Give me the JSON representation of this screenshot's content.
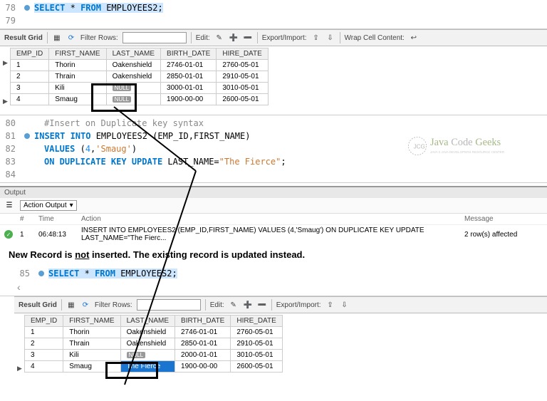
{
  "editor1": {
    "l78": {
      "no": "78",
      "sql": {
        "select": "SELECT",
        "star": "*",
        "from": "FROM",
        "tbl": "EMPLOYEES2",
        "semi": ";"
      }
    },
    "l79": {
      "no": "79"
    }
  },
  "toolbar": {
    "resultgrid": "Result Grid",
    "filter": "Filter Rows:",
    "edit": "Edit:",
    "expimp": "Export/Import:",
    "wrap": "Wrap Cell Content:"
  },
  "table1": {
    "hdr": {
      "c1": "EMP_ID",
      "c2": "FIRST_NAME",
      "c3": "LAST_NAME",
      "c4": "BIRTH_DATE",
      "c5": "HIRE_DATE"
    },
    "rows": [
      {
        "c1": "1",
        "c2": "Thorin",
        "c3": "Oakenshield",
        "c4": "2746-01-01",
        "c5": "2760-05-01"
      },
      {
        "c1": "2",
        "c2": "Thrain",
        "c3": "Oakenshield",
        "c4": "2850-01-01",
        "c5": "2910-05-01"
      },
      {
        "c1": "3",
        "c2": "Kili",
        "c3": "NULL",
        "c4": "3000-01-01",
        "c5": "3010-05-01"
      },
      {
        "c1": "4",
        "c2": "Smaug",
        "c3": "NULL",
        "c4": "1900-00-00",
        "c5": "2600-05-01"
      }
    ]
  },
  "editor2": {
    "l80": {
      "no": "80",
      "cmt": "#Insert on Duplicate key syntax"
    },
    "l81": {
      "no": "81",
      "p1": "INSERT INTO",
      "p2": " EMPLOYEES2",
      "p3": " (EMP_ID,FIRST_NAME)"
    },
    "l82": {
      "no": "82",
      "p1": "VALUES",
      "p2": " (",
      "p3": "4",
      "p4": ",",
      "p5": "'Smaug'",
      "p6": ")"
    },
    "l83": {
      "no": "83",
      "p1": "ON DUPLICATE KEY UPDATE",
      "p2": " LAST_NAME=",
      "p3": "\"The Fierce\"",
      "p4": ";"
    },
    "l84": {
      "no": "84"
    }
  },
  "output": {
    "title": "Output",
    "mode": "Action Output",
    "hcol1": "#",
    "hcol2": "Time",
    "hcol3": "Action",
    "hcol4": "Message",
    "rownum": "1",
    "time": "06:48:13",
    "action": "INSERT INTO EMPLOYEES2 (EMP_ID,FIRST_NAME) VALUES (4,'Smaug') ON DUPLICATE KEY UPDATE LAST_NAME=\"The Fierc...",
    "msg": "2 row(s) affected"
  },
  "annotation": {
    "p1": "New Record is ",
    "p2": "not",
    "p3": " inserted. The existing record is updated instead."
  },
  "editor3": {
    "l85": {
      "no": "85",
      "sql": {
        "select": "SELECT",
        "star": "*",
        "from": "FROM",
        "tbl": "EMPLOYEES2",
        "semi": ";"
      }
    }
  },
  "table2": {
    "hdr": {
      "c1": "EMP_ID",
      "c2": "FIRST_NAME",
      "c3": "LAST_NAME",
      "c4": "BIRTH_DATE",
      "c5": "HIRE_DATE"
    },
    "rows": [
      {
        "c1": "1",
        "c2": "Thorin",
        "c3": "Oakenshield",
        "c4": "2746-01-01",
        "c5": "2760-05-01"
      },
      {
        "c1": "2",
        "c2": "Thrain",
        "c3": "Oakenshield",
        "c4": "2850-01-01",
        "c5": "2910-05-01"
      },
      {
        "c1": "3",
        "c2": "Kili",
        "c3": "NULL",
        "c4": "2000-01-01",
        "c5": "3010-05-01"
      },
      {
        "c1": "4",
        "c2": "Smaug",
        "c3": "The Fierce",
        "c4": "1900-00-00",
        "c5": "2600-05-01"
      }
    ]
  },
  "logo": {
    "t1": "Java",
    "t2": "Code",
    "t3": "Geeks",
    "sub": "JAVA 2 JAVA DEVELOPERS RESOURCE CENTER"
  }
}
